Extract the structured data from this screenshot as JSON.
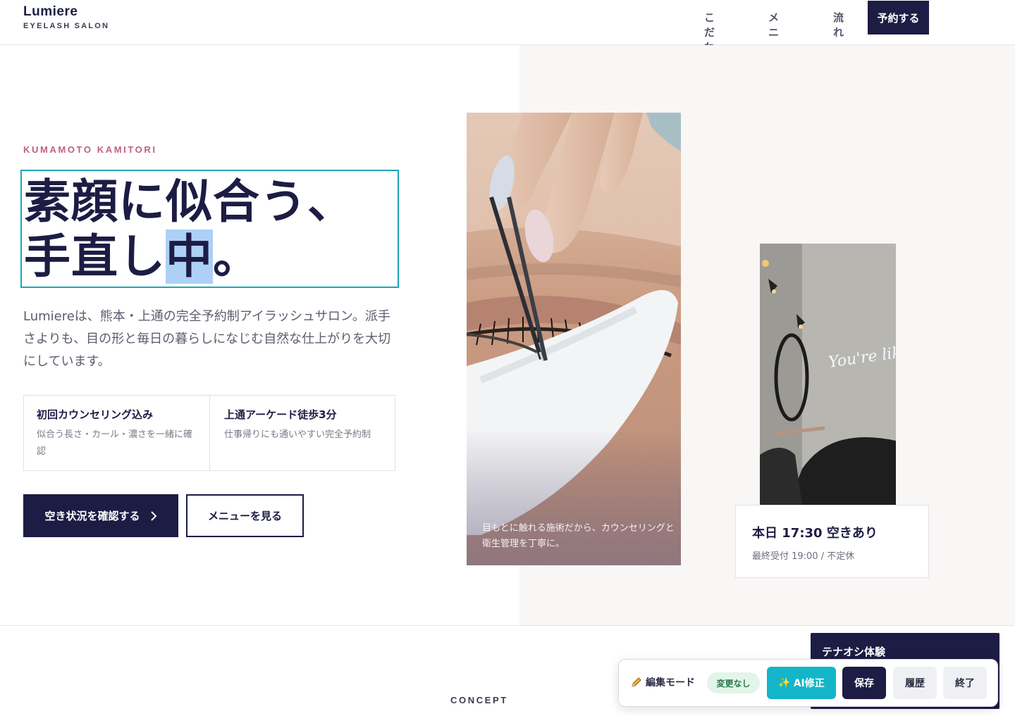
{
  "header": {
    "logo_name": "Lumiere",
    "logo_sub": "EYELASH SALON",
    "nav": [
      "こだわり",
      "メニュー",
      "流れ"
    ],
    "reserve_label": "予約する"
  },
  "hero": {
    "kicker": "KUMAMOTO KAMITORI",
    "headline_line1": "素顔に似合う、",
    "headline_line2_pre": "手直し",
    "headline_line2_selected": "中",
    "headline_line2_post": "。",
    "lead": "Lumiereは、熊本・上通の完全予約制アイラッシュサロン。派手さよりも、目の形と毎日の暮らしになじむ自然な仕上がりを大切にしています。",
    "features": [
      {
        "title": "初回カウンセリング込み",
        "text": "似合う長さ・カール・濃さを一緒に確認"
      },
      {
        "title": "上通アーケード徒歩3分",
        "text": "仕事帰りにも通いやすい完全予約制"
      }
    ],
    "cta_primary": "空き状況を確認する",
    "cta_secondary": "メニューを見る",
    "photo_caption": "目もとに触れる施術だから、カウンセリングと衛生管理を丁寧に。",
    "neon_text": "You're like, Really pr",
    "info_title": "本日 17:30 空きあり",
    "info_sub": "最終受付 19:00 / 不定休"
  },
  "concept": {
    "kicker": "CONCEPT"
  },
  "tenaoshi": {
    "title": "テナオシ体験"
  },
  "toolbar": {
    "mode_label": "編集モード",
    "status_badge": "変更なし",
    "ai_label": "AI修正",
    "save_label": "保存",
    "history_label": "履歴",
    "end_label": "終了"
  },
  "colors": {
    "navy": "#1c1c44",
    "accent_pink": "#c0627a",
    "teal": "#13b6c8",
    "selection": "#acd0f6"
  }
}
